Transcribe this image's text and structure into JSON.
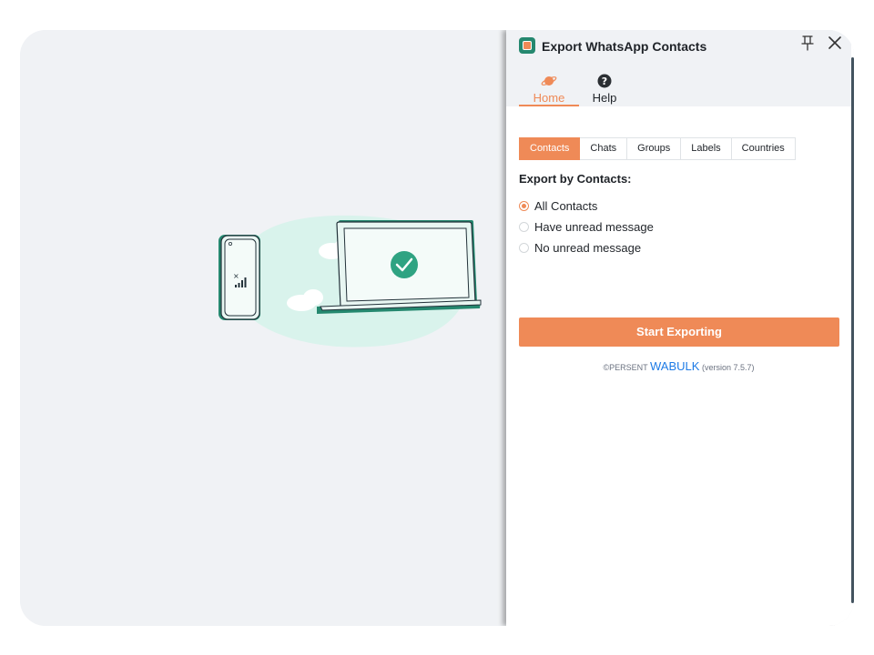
{
  "panel": {
    "title": "Export WhatsApp Contacts",
    "nav": [
      {
        "label": "Home",
        "icon": "planet-icon",
        "active": true
      },
      {
        "label": "Help",
        "icon": "question-circle-icon",
        "active": false
      }
    ],
    "tabs": [
      "Contacts",
      "Chats",
      "Groups",
      "Labels",
      "Countries"
    ],
    "active_tab": "Contacts",
    "section_title": "Export by Contacts:",
    "options": [
      {
        "label": "All Contacts",
        "checked": true
      },
      {
        "label": "Have unread message",
        "checked": false
      },
      {
        "label": "No unread message",
        "checked": false
      }
    ],
    "start_button": "Start Exporting",
    "footer": {
      "copyright": "©PERSENT",
      "brand": "WABULK",
      "version": "(version 7.5.7)"
    }
  },
  "colors": {
    "accent": "#ef8a57",
    "brand_link": "#1e7be6",
    "illustration_green": "#25886f",
    "background": "#f0f2f5"
  }
}
